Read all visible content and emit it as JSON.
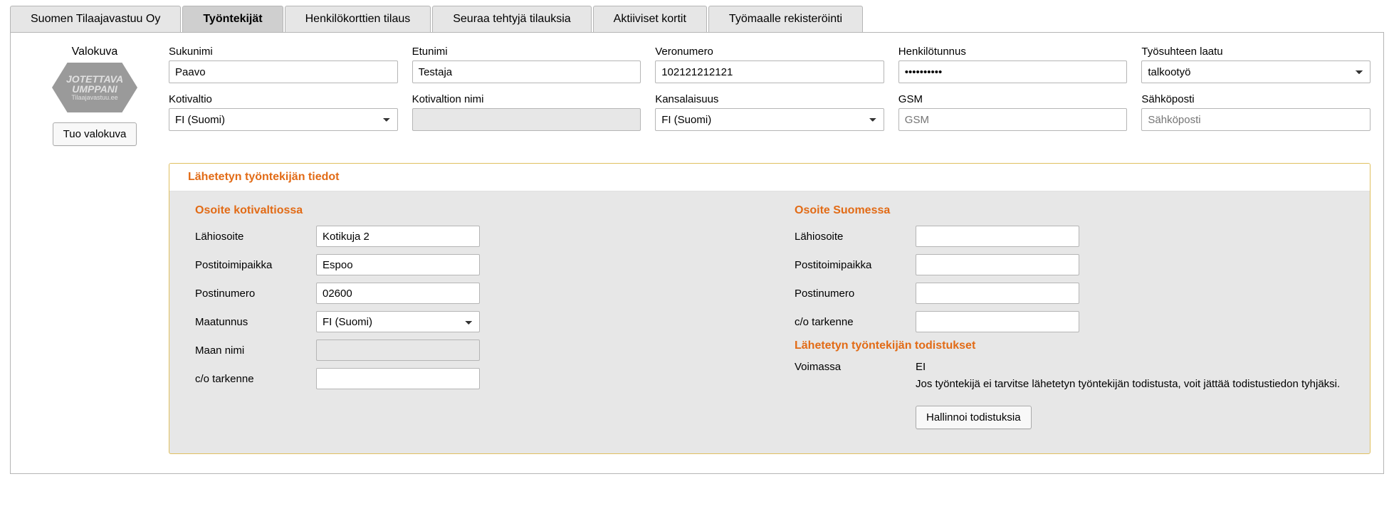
{
  "tabs": {
    "t0": "Suomen Tilaajavastuu Oy",
    "t1": "Työntekijät",
    "t2": "Henkilökorttien tilaus",
    "t3": "Seuraa tehtyjä tilauksia",
    "t4": "Aktiiviset kortit",
    "t5": "Työmaalle rekisteröinti"
  },
  "photo": {
    "label": "Valokuva",
    "badge_line1": "JOTETTAVA",
    "badge_line2": "UMPPANI",
    "badge_sub": "Tilaajavastuu.ee",
    "upload_btn": "Tuo valokuva"
  },
  "fields": {
    "sukunimi_lbl": "Sukunimi",
    "sukunimi_val": "Paavo",
    "etunimi_lbl": "Etunimi",
    "etunimi_val": "Testaja",
    "veronumero_lbl": "Veronumero",
    "veronumero_val": "102121212121",
    "hetu_lbl": "Henkilötunnus",
    "hetu_val": "••••••••••",
    "tyosuhde_lbl": "Työsuhteen laatu",
    "tyosuhde_val": "talkootyö",
    "kotivaltio_lbl": "Kotivaltio",
    "kotivaltio_val": "FI (Suomi)",
    "kotivaltionimi_lbl": "Kotivaltion nimi",
    "kotivaltionimi_val": "",
    "kansalaisuus_lbl": "Kansalaisuus",
    "kansalaisuus_val": "FI (Suomi)",
    "gsm_lbl": "GSM",
    "gsm_ph": "GSM",
    "email_lbl": "Sähköposti",
    "email_ph": "Sähköposti"
  },
  "panel": {
    "header": "Lähetetyn työntekijän tiedot",
    "addr_home_title": "Osoite kotivaltiossa",
    "addr_fi_title": "Osoite Suomessa",
    "lahiosoite_lbl": "Lähiosoite",
    "postitoimipaikka_lbl": "Postitoimipaikka",
    "postinumero_lbl": "Postinumero",
    "maatunnus_lbl": "Maatunnus",
    "maannimi_lbl": "Maan nimi",
    "co_lbl": "c/o tarkenne",
    "home": {
      "lahiosoite": "Kotikuja 2",
      "postitoimipaikka": "Espoo",
      "postinumero": "02600",
      "maatunnus": "FI (Suomi)",
      "maannimi": "",
      "co": ""
    },
    "fi": {
      "lahiosoite": "",
      "postitoimipaikka": "",
      "postinumero": "",
      "co": ""
    },
    "cert_title": "Lähetetyn työntekijän todistukset",
    "voimassa_lbl": "Voimassa",
    "voimassa_val": "EI",
    "cert_note": "Jos työntekijä ei tarvitse lähetetyn työntekijän todistusta, voit jättää todistustiedon tyhjäksi.",
    "cert_btn": "Hallinnoi todistuksia"
  }
}
